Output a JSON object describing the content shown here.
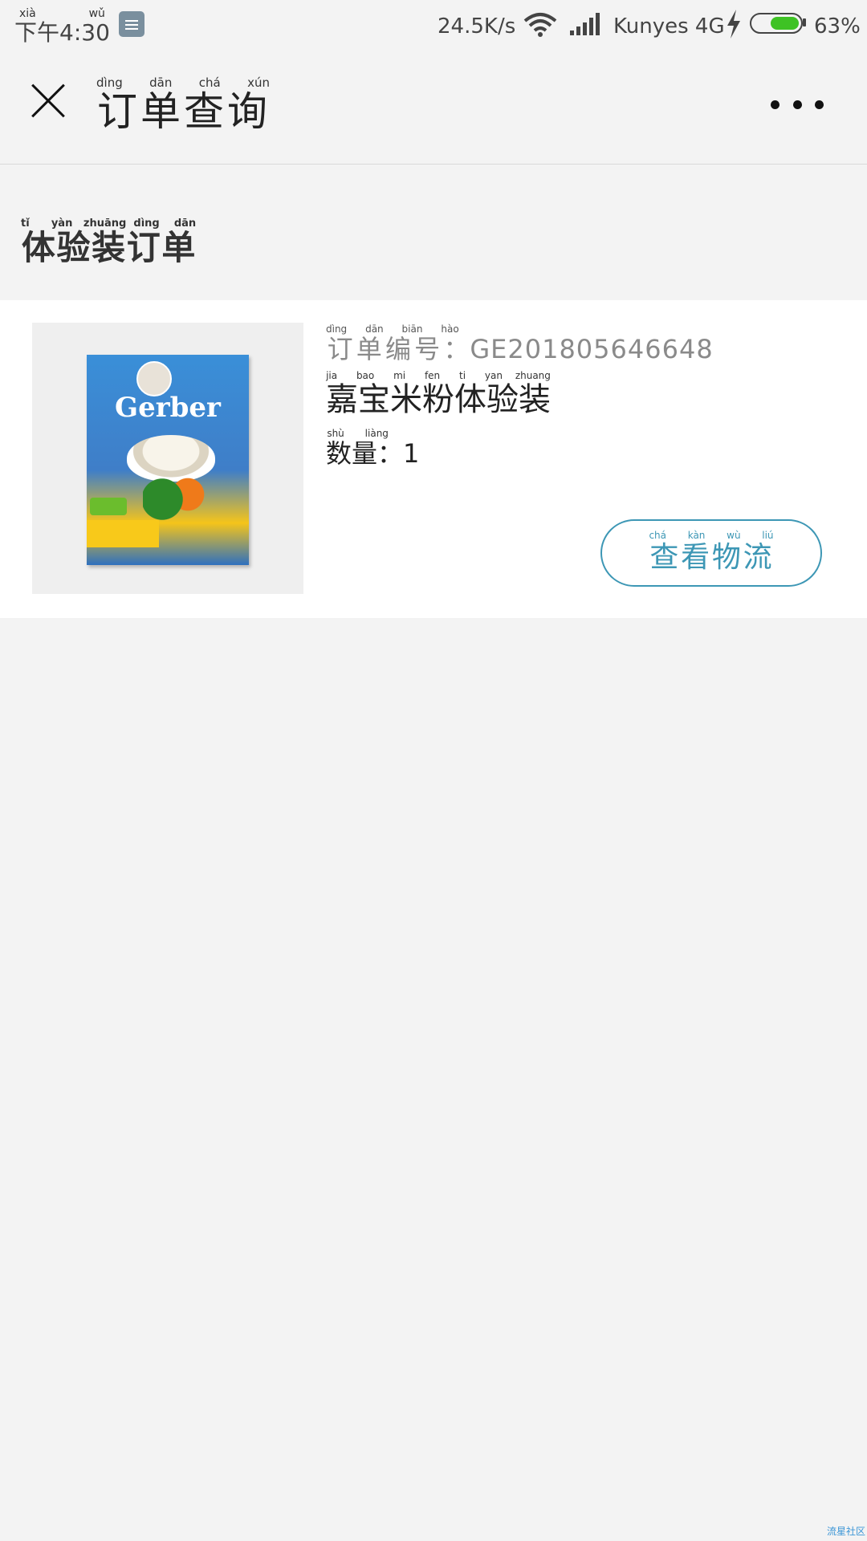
{
  "status_bar": {
    "time": "下午4:30",
    "time_pinyin": [
      "xià",
      "wǔ"
    ],
    "network_speed": "24.5K/s",
    "carrier": "Kunyes 4G",
    "battery_percent": "63%",
    "battery_level": 0.63,
    "battery_color": "#3ec224",
    "icons": [
      "notification-icon",
      "wifi-icon",
      "signal-icon",
      "charging-icon",
      "battery-icon"
    ]
  },
  "header": {
    "title": "订单查询",
    "title_pinyin": [
      "dìng",
      "dān",
      "chá",
      "xún"
    ],
    "close_icon": "close-icon",
    "more_icon": "more-icon"
  },
  "section": {
    "title": "体验装订单",
    "title_pinyin": [
      "tǐ",
      "yàn",
      "zhuāng",
      "dìng",
      "dān"
    ]
  },
  "order": {
    "number_label": "订单编号：",
    "number_label_pinyin": [
      "dìng",
      "dān",
      "biān",
      "hào"
    ],
    "number_value": "GE201805646648",
    "product_name": "嘉宝米粉体验装",
    "product_name_pinyin": [
      "jia",
      "bao",
      "mi",
      "fen",
      "ti",
      "yan",
      "zhuang"
    ],
    "quantity_label": "数量：",
    "quantity_label_pinyin": [
      "shù",
      "liàng"
    ],
    "quantity_value": "1",
    "image_brand": "Gerber",
    "logistics_button": "查看物流",
    "logistics_button_pinyin": [
      "chá",
      "kàn",
      "wù",
      "liú"
    ],
    "accent_color": "#3d97b5"
  },
  "watermark": "流星社区"
}
